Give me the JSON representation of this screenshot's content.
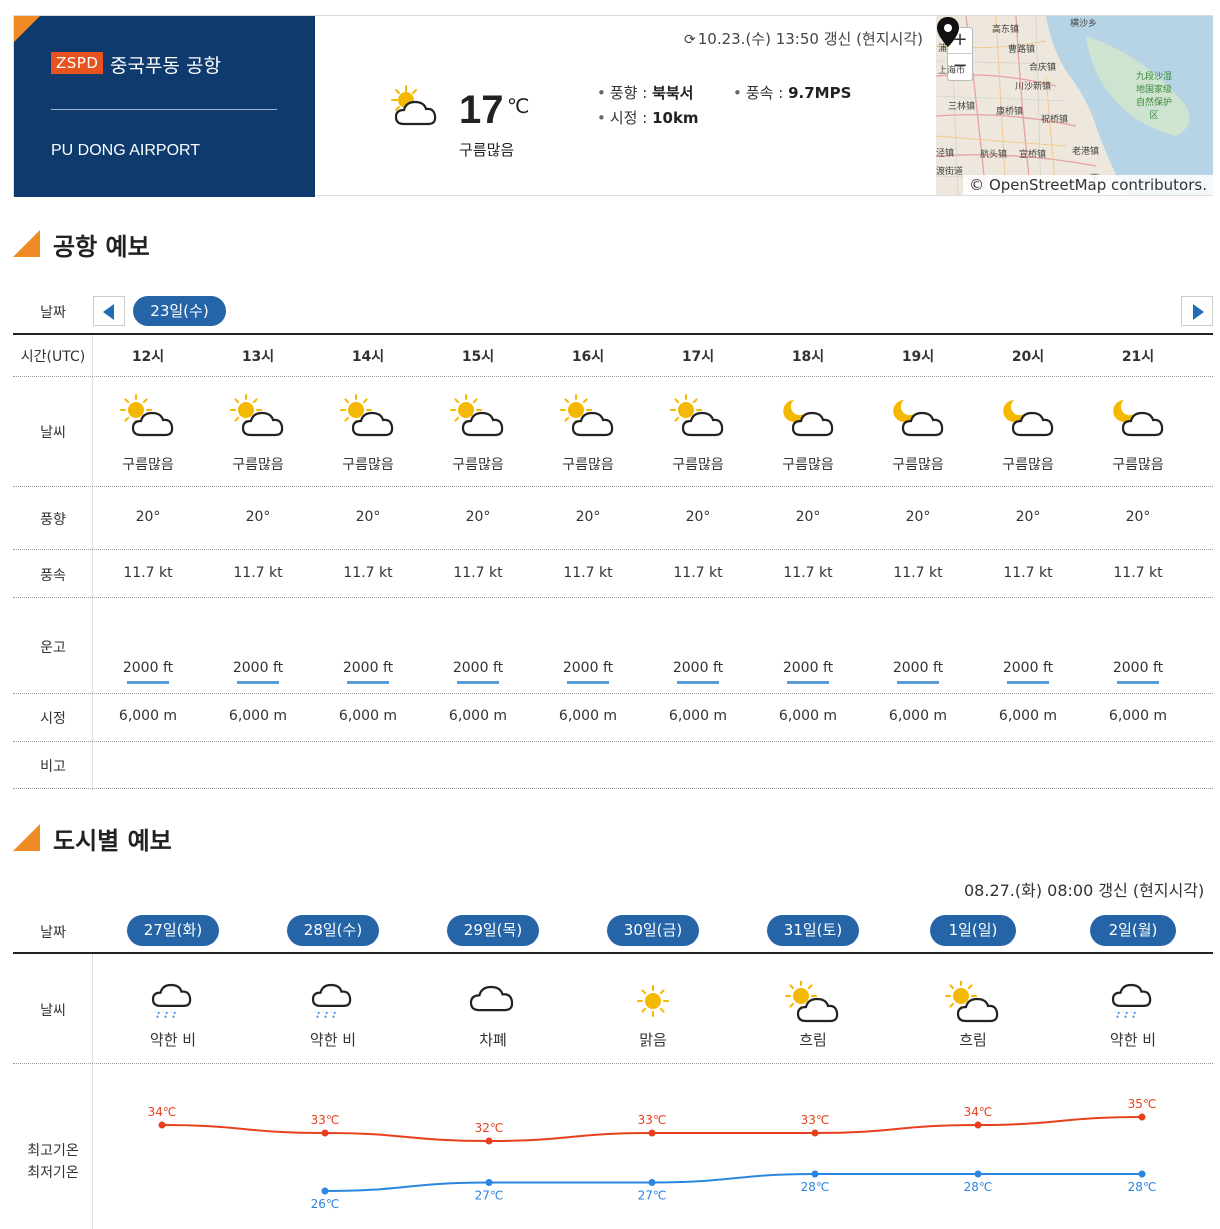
{
  "header": {
    "code": "ZSPD",
    "name_ko": "중국푸동 공항",
    "name_en": "PU DONG AIRPORT",
    "updated": "10.23.(수) 13:50 갱신 (현지시각)",
    "current": {
      "temp": "17",
      "unit": "℃",
      "condition": "구름많음",
      "icon": "partly-cloudy-icon",
      "wind_dir_label": "풍향 :",
      "wind_dir": "북북서",
      "wind_speed_label": "풍속 :",
      "wind_speed": "9.7MPS",
      "visibility_label": "시정 :",
      "visibility": "10km"
    },
    "map": {
      "attribution": "© OpenStreetMap contributors.",
      "zoom_in": "+",
      "zoom_out": "−",
      "labels": [
        "高东镇",
        "横沙乡",
        "曹路镇",
        "合庆镇",
        "川沙新镇",
        "康桥镇",
        "祝桥镇",
        "三林镇",
        "航头镇",
        "宣桥镇",
        "老港镇",
        "九段沙湿地国家级自然保护区",
        "上海市",
        "浦",
        "渡街道",
        "泾镇",
        "下"
      ]
    }
  },
  "airport_forecast": {
    "title": "공항 예보",
    "labels": {
      "date": "날짜",
      "time": "시간(UTC)",
      "weather": "날씨",
      "wind_dir": "풍향",
      "wind_speed": "풍속",
      "ceiling": "운고",
      "visibility": "시정",
      "remarks": "비고"
    },
    "selected_date": "23일(수)",
    "hours": [
      {
        "time": "12시",
        "icon": "partly-cloudy-day-icon",
        "cond": "구름많음",
        "wdir": "20°",
        "wspd": "11.7 kt",
        "ceil": "2000 ft",
        "vis": "6,000 m"
      },
      {
        "time": "13시",
        "icon": "partly-cloudy-day-icon",
        "cond": "구름많음",
        "wdir": "20°",
        "wspd": "11.7 kt",
        "ceil": "2000 ft",
        "vis": "6,000 m"
      },
      {
        "time": "14시",
        "icon": "partly-cloudy-day-icon",
        "cond": "구름많음",
        "wdir": "20°",
        "wspd": "11.7 kt",
        "ceil": "2000 ft",
        "vis": "6,000 m"
      },
      {
        "time": "15시",
        "icon": "partly-cloudy-day-icon",
        "cond": "구름많음",
        "wdir": "20°",
        "wspd": "11.7 kt",
        "ceil": "2000 ft",
        "vis": "6,000 m"
      },
      {
        "time": "16시",
        "icon": "partly-cloudy-day-icon",
        "cond": "구름많음",
        "wdir": "20°",
        "wspd": "11.7 kt",
        "ceil": "2000 ft",
        "vis": "6,000 m"
      },
      {
        "time": "17시",
        "icon": "partly-cloudy-day-icon",
        "cond": "구름많음",
        "wdir": "20°",
        "wspd": "11.7 kt",
        "ceil": "2000 ft",
        "vis": "6,000 m"
      },
      {
        "time": "18시",
        "icon": "partly-cloudy-night-icon",
        "cond": "구름많음",
        "wdir": "20°",
        "wspd": "11.7 kt",
        "ceil": "2000 ft",
        "vis": "6,000 m"
      },
      {
        "time": "19시",
        "icon": "partly-cloudy-night-icon",
        "cond": "구름많음",
        "wdir": "20°",
        "wspd": "11.7 kt",
        "ceil": "2000 ft",
        "vis": "6,000 m"
      },
      {
        "time": "20시",
        "icon": "partly-cloudy-night-icon",
        "cond": "구름많음",
        "wdir": "20°",
        "wspd": "11.7 kt",
        "ceil": "2000 ft",
        "vis": "6,000 m"
      },
      {
        "time": "21시",
        "icon": "partly-cloudy-night-icon",
        "cond": "구름많음",
        "wdir": "20°",
        "wspd": "11.7 kt",
        "ceil": "2000 ft",
        "vis": "6,000 m"
      }
    ]
  },
  "city_forecast": {
    "title": "도시별 예보",
    "updated": "08.27.(화) 08:00 갱신 (현지시각)",
    "labels": {
      "date": "날짜",
      "weather": "날씨",
      "max": "최고기온",
      "min": "최저기온"
    },
    "days": [
      {
        "date": "27일(화)",
        "icon": "light-rain-icon",
        "cond": "약한 비"
      },
      {
        "date": "28일(수)",
        "icon": "light-rain-icon",
        "cond": "약한 비"
      },
      {
        "date": "29일(목)",
        "icon": "overcast-icon",
        "cond": "차폐"
      },
      {
        "date": "30일(금)",
        "icon": "sunny-icon",
        "cond": "맑음"
      },
      {
        "date": "31일(토)",
        "icon": "partly-cloudy-icon",
        "cond": "흐림"
      },
      {
        "date": "1일(일)",
        "icon": "partly-cloudy-icon",
        "cond": "흐림"
      },
      {
        "date": "2일(월)",
        "icon": "light-rain-icon",
        "cond": "약한 비"
      }
    ],
    "colors": {
      "max": "#e8401c",
      "min": "#2a86e0"
    }
  },
  "chart_data": {
    "type": "line",
    "categories": [
      "27일(화)",
      "28일(수)",
      "29일(목)",
      "30일(금)",
      "31일(토)",
      "1일(일)",
      "2일(월)"
    ],
    "series": [
      {
        "name": "최고기온",
        "values": [
          34,
          33,
          32,
          33,
          33,
          34,
          35
        ],
        "labels": [
          "34℃",
          "33℃",
          "32℃",
          "33℃",
          "33℃",
          "34℃",
          "35℃"
        ]
      },
      {
        "name": "최저기온",
        "values": [
          null,
          26,
          27,
          27,
          28,
          28,
          28
        ],
        "labels": [
          "",
          "26℃",
          "27℃",
          "27℃",
          "28℃",
          "28℃",
          "28℃"
        ]
      }
    ],
    "ylim": [
      20,
      40
    ]
  }
}
